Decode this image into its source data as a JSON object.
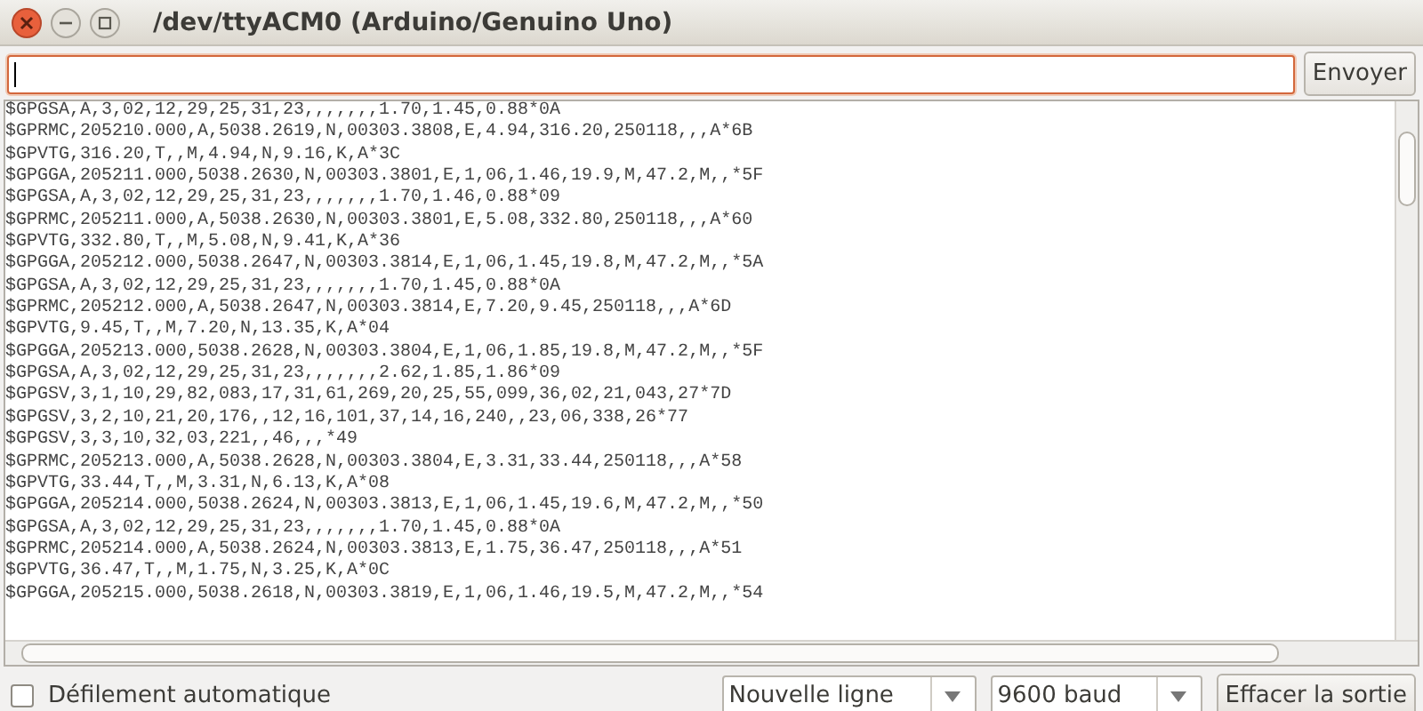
{
  "window": {
    "title": "/dev/ttyACM0 (Arduino/Genuino Uno)"
  },
  "send": {
    "button": "Envoyer"
  },
  "output": {
    "lines": [
      "$GPGSA,A,3,02,12,29,25,31,23,,,,,,,1.70,1.45,0.88*0A",
      "$GPRMC,205210.000,A,5038.2619,N,00303.3808,E,4.94,316.20,250118,,,A*6B",
      "$GPVTG,316.20,T,,M,4.94,N,9.16,K,A*3C",
      "$GPGGA,205211.000,5038.2630,N,00303.3801,E,1,06,1.46,19.9,M,47.2,M,,*5F",
      "$GPGSA,A,3,02,12,29,25,31,23,,,,,,,1.70,1.46,0.88*09",
      "$GPRMC,205211.000,A,5038.2630,N,00303.3801,E,5.08,332.80,250118,,,A*60",
      "$GPVTG,332.80,T,,M,5.08,N,9.41,K,A*36",
      "$GPGGA,205212.000,5038.2647,N,00303.3814,E,1,06,1.45,19.8,M,47.2,M,,*5A",
      "$GPGSA,A,3,02,12,29,25,31,23,,,,,,,1.70,1.45,0.88*0A",
      "$GPRMC,205212.000,A,5038.2647,N,00303.3814,E,7.20,9.45,250118,,,A*6D",
      "$GPVTG,9.45,T,,M,7.20,N,13.35,K,A*04",
      "$GPGGA,205213.000,5038.2628,N,00303.3804,E,1,06,1.85,19.8,M,47.2,M,,*5F",
      "$GPGSA,A,3,02,12,29,25,31,23,,,,,,,2.62,1.85,1.86*09",
      "$GPGSV,3,1,10,29,82,083,17,31,61,269,20,25,55,099,36,02,21,043,27*7D",
      "$GPGSV,3,2,10,21,20,176,,12,16,101,37,14,16,240,,23,06,338,26*77",
      "$GPGSV,3,3,10,32,03,221,,46,,,*49",
      "$GPRMC,205213.000,A,5038.2628,N,00303.3804,E,3.31,33.44,250118,,,A*58",
      "$GPVTG,33.44,T,,M,3.31,N,6.13,K,A*08",
      "$GPGGA,205214.000,5038.2624,N,00303.3813,E,1,06,1.45,19.6,M,47.2,M,,*50",
      "$GPGSA,A,3,02,12,29,25,31,23,,,,,,,1.70,1.45,0.88*0A",
      "$GPRMC,205214.000,A,5038.2624,N,00303.3813,E,1.75,36.47,250118,,,A*51",
      "$GPVTG,36.47,T,,M,1.75,N,3.25,K,A*0C",
      "$GPGGA,205215.000,5038.2618,N,00303.3819,E,1,06,1.46,19.5,M,47.2,M,,*54"
    ]
  },
  "autoscroll": {
    "label": "Défilement automatique",
    "checked": false
  },
  "line_ending": {
    "value": "Nouvelle ligne"
  },
  "baud": {
    "value": "9600 baud"
  },
  "clear_button": {
    "label": "Effacer la sortie"
  }
}
